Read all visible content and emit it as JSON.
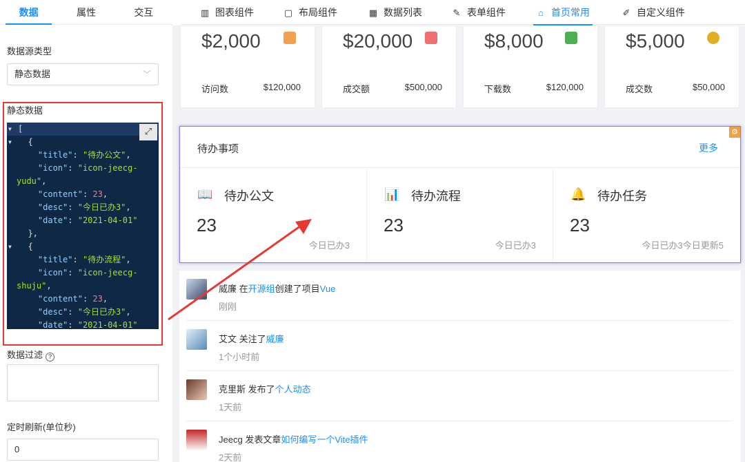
{
  "left_panel": {
    "tabs": [
      "数据",
      "属性",
      "交互"
    ],
    "datasource_type_label": "数据源类型",
    "datasource_value": "静态数据",
    "static_data_label": "静态数据",
    "code_lines": [
      "[",
      "  {",
      "    \"title\": \"待办公文\",",
      "    \"icon\": \"icon-jeecg-",
      "yudu\",",
      "    \"content\": 23,",
      "    \"desc\": \"今日已办3\",",
      "    \"date\": \"2021-04-01\"",
      "  },",
      "  {",
      "    \"title\": \"待办流程\",",
      "    \"icon\": \"icon-jeecg-",
      "shuju\",",
      "    \"content\": 23,",
      "    \"desc\": \"今日已办3\",",
      "    \"date\": \"2021-04-01\""
    ],
    "filter_label": "数据过滤",
    "refresh_label": "定时刷新(单位秒)",
    "refresh_value": "0"
  },
  "topnav": {
    "items": [
      {
        "label": "图表组件",
        "icon": "bar-chart-icon"
      },
      {
        "label": "布局组件",
        "icon": "layout-icon"
      },
      {
        "label": "数据列表",
        "icon": "table-icon"
      },
      {
        "label": "表单组件",
        "icon": "edit-icon"
      },
      {
        "label": "首页常用",
        "icon": "home-icon",
        "active": true
      },
      {
        "label": "自定义组件",
        "icon": "custom-icon"
      }
    ]
  },
  "stats": [
    {
      "amount": "$2,000",
      "label": "访问数",
      "value": "$120,000",
      "icon": "wallet-icon",
      "color": "#f0a050"
    },
    {
      "amount": "$20,000",
      "label": "成交额",
      "value": "$500,000",
      "icon": "coupon-icon",
      "color": "#f07070"
    },
    {
      "amount": "$8,000",
      "label": "下载数",
      "value": "$120,000",
      "icon": "image-icon",
      "color": "#4caf50"
    },
    {
      "amount": "$5,000",
      "label": "成交数",
      "value": "$50,000",
      "icon": "coin-icon",
      "color": "#e0b020"
    }
  ],
  "todo": {
    "title": "待办事项",
    "more": "更多",
    "items": [
      {
        "name": "待办公文",
        "count": "23",
        "desc": "今日已办3",
        "icon": "book-icon"
      },
      {
        "name": "待办流程",
        "count": "23",
        "desc": "今日已办3",
        "icon": "chart-icon"
      },
      {
        "name": "待办任务",
        "count": "23",
        "desc": "今日已办3今日更新5",
        "icon": "bell-icon"
      }
    ]
  },
  "feed": [
    {
      "user": "威廉",
      "action": " 在",
      "link1": "开源组",
      "action2": "创建了项目",
      "link2": "Vue",
      "time": "刚刚"
    },
    {
      "user": "艾文",
      "action": " 关注了",
      "link1": "威廉",
      "action2": "",
      "link2": "",
      "time": "1个小时前"
    },
    {
      "user": "克里斯",
      "action": " 发布了",
      "link1": "个人动态",
      "action2": "",
      "link2": "",
      "time": "1天前"
    },
    {
      "user": "Jeecg",
      "action": " 发表文章",
      "link1": "如何编写一个Vite插件",
      "action2": "",
      "link2": "",
      "time": "2天前"
    }
  ],
  "colors": {
    "accent": "#1890ff",
    "annotation": "#e53935",
    "editor_bg": "#0f2846"
  }
}
